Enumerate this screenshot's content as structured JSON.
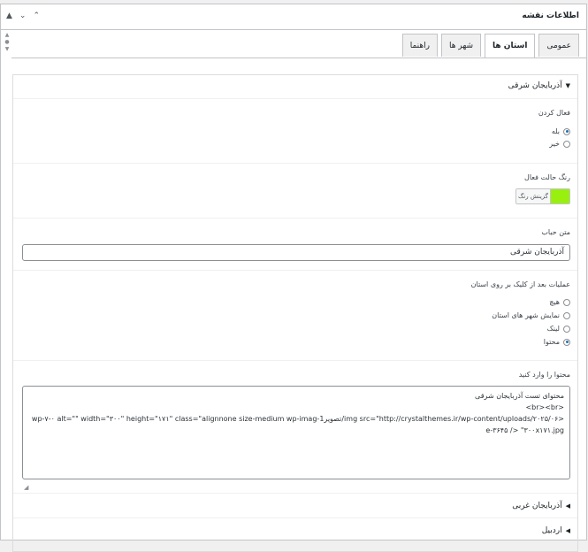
{
  "metabox": {
    "title": "اطلاعات نقشه",
    "controls": {
      "up": "^",
      "down": "v",
      "toggle": "▲"
    }
  },
  "tabs": [
    {
      "label": "عمومی",
      "active": false
    },
    {
      "label": "استان ها",
      "active": true
    },
    {
      "label": "شهر ها",
      "active": false
    },
    {
      "label": "راهنما",
      "active": false
    }
  ],
  "province_open": {
    "title": "آذربایجان شرقی",
    "enable": {
      "label": "فعال کردن",
      "options": [
        {
          "label": "بله",
          "checked": true
        },
        {
          "label": "خیر",
          "checked": false
        }
      ]
    },
    "active_color": {
      "label": "رنگ حالت فعال",
      "button_label": "گزینش رنگ",
      "color": "#99f00e"
    },
    "bubble_text": {
      "label": "متن حباب",
      "value": "آذربایجان شرقی"
    },
    "click_action": {
      "label": "عملیات بعد از کلیک بر روی استان",
      "options": [
        {
          "label": "هیچ",
          "checked": false
        },
        {
          "label": "نمایش شهر های استان",
          "checked": false
        },
        {
          "label": "لینک",
          "checked": false
        },
        {
          "label": "محتوا",
          "checked": true
        }
      ]
    },
    "content": {
      "label": "محتوا را وارد کنید",
      "value": "محتوای تست آذربایجان شرقی\n<br><br>\n<img src=\"http://crystalthemes.ir/wp-content/uploads/۲۰۲۵/۰۶/تصویر1-wp-۷-۰ alt=\"\" width=\"۳۰۰\" height=\"۱۷۱\" class=\"alignnone size-medium wp-image-۳۶۴۵ /> \"۳۰۰x۱۷۱.jpg"
    }
  },
  "provinces_collapsed": [
    {
      "title": "آذربایجان غربی"
    },
    {
      "title": "اردبیل"
    }
  ]
}
